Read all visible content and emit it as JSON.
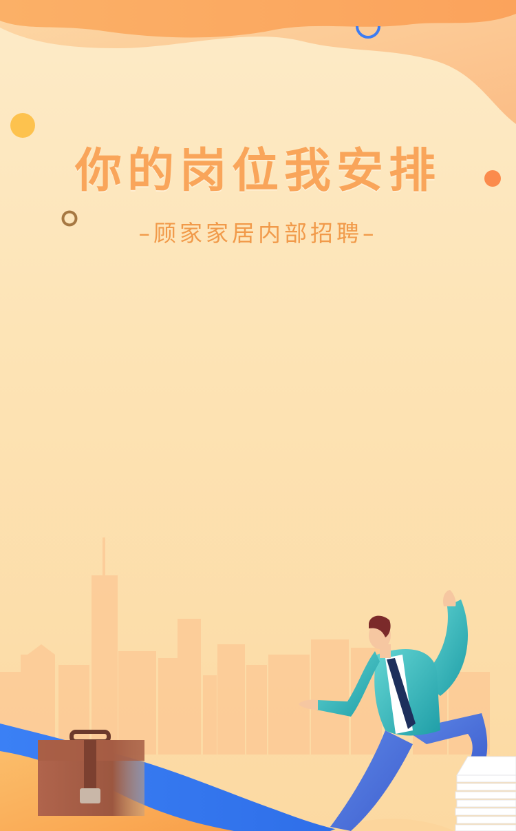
{
  "poster": {
    "title": "你的岗位我安排",
    "subtitle": "–顾家家居内部招聘–"
  },
  "colors": {
    "background_top": "#fdebc8",
    "background_bottom": "#fcd9a2",
    "title": "#f9a55a",
    "subtitle": "#f19a4a",
    "accent_orange": "#fb8b4c",
    "accent_yellow": "#fdc24e",
    "accent_blue": "#3d7cf2",
    "ring_brown": "#a67842",
    "suit_teal": "#2fb7b8",
    "pants_blue": "#4a6fdb",
    "briefcase": "#a55f45"
  }
}
